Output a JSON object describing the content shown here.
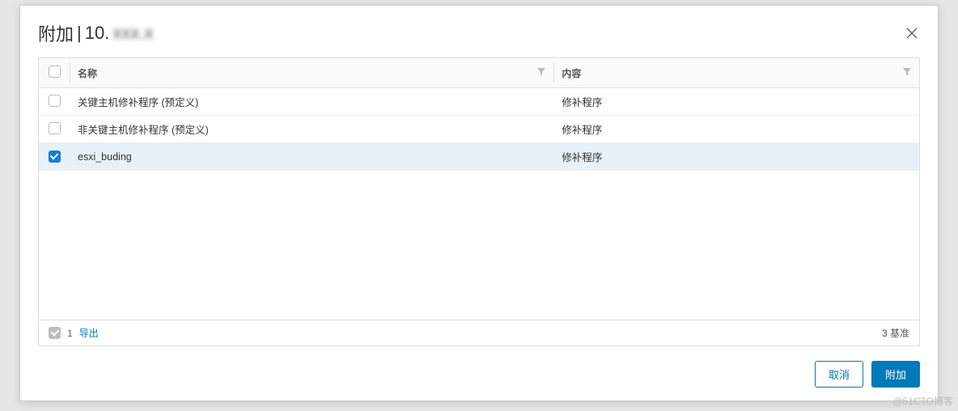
{
  "dialog": {
    "title_prefix": "附加",
    "title_sep": "|",
    "title_ip_visible": "10.",
    "title_ip_blurred": "xxx.x"
  },
  "columns": {
    "name": "名称",
    "content": "内容"
  },
  "rows": [
    {
      "checked": false,
      "name": "关键主机修补程序 (预定义)",
      "content": "修补程序",
      "selected": false
    },
    {
      "checked": false,
      "name": "非关键主机修补程序 (预定义)",
      "content": "修补程序",
      "selected": false
    },
    {
      "checked": true,
      "name": "esxi_buding",
      "content": "修补程序",
      "selected": true
    }
  ],
  "footer": {
    "selected_count": "1",
    "export_label": "导出",
    "total_label": "3 基准"
  },
  "actions": {
    "cancel": "取消",
    "attach": "附加"
  },
  "watermark": "@51CTO博客"
}
